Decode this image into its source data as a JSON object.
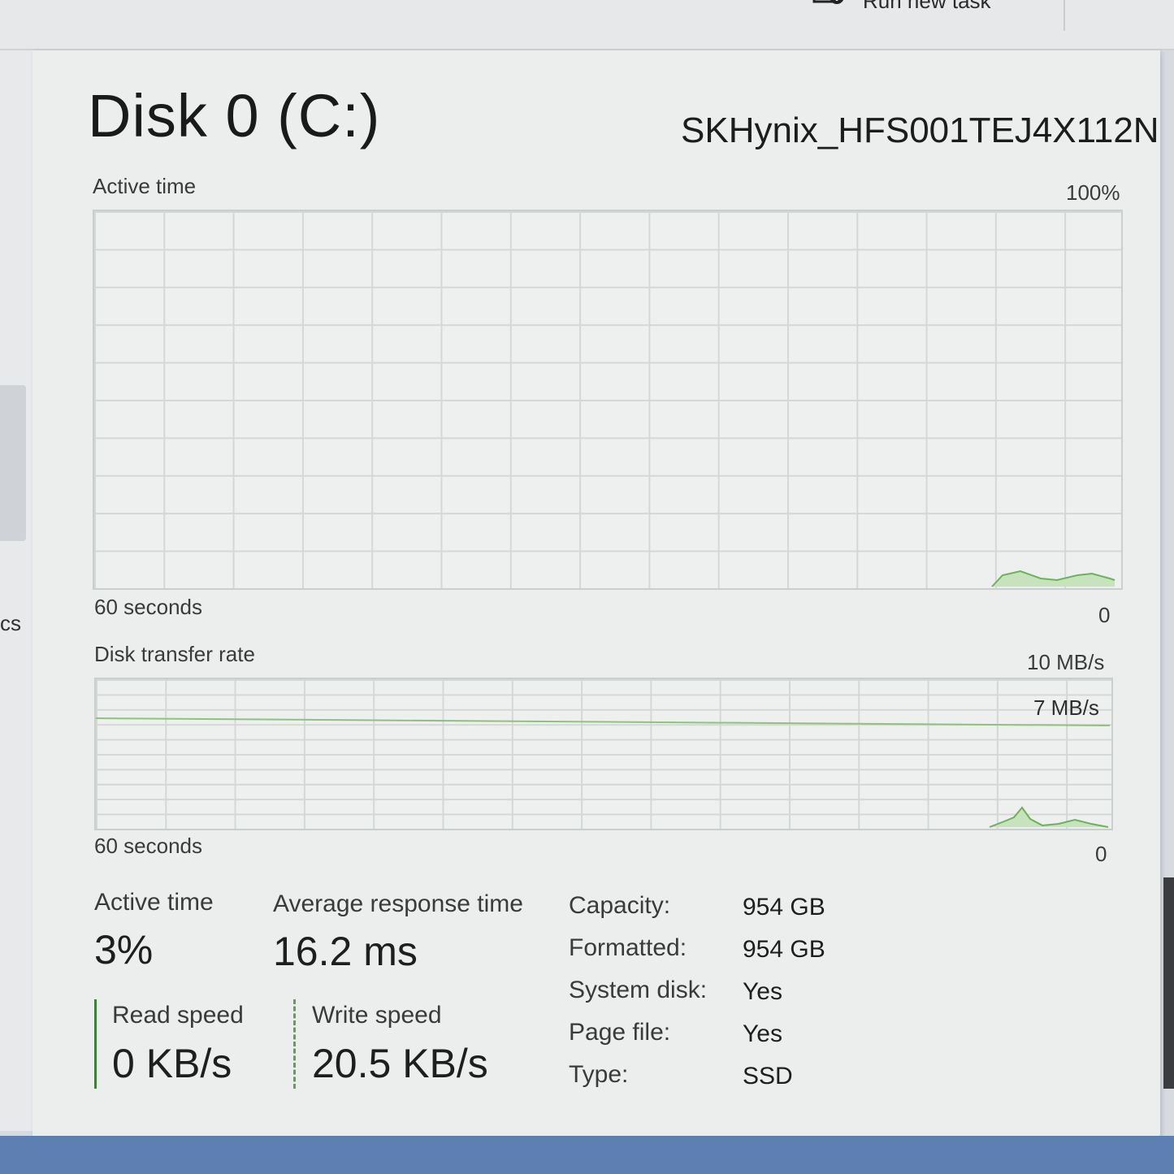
{
  "toolbar": {
    "run_new_task_label": "Run new task"
  },
  "sidebar": {
    "partial_label": "cs"
  },
  "disk": {
    "title": "Disk 0 (C:)",
    "model": "SKHynix_HFS001TEJ4X112N"
  },
  "active_time_graph": {
    "label": "Active time",
    "max_label": "100%",
    "time_label": "60 seconds",
    "min_label": "0"
  },
  "transfer_graph": {
    "label": "Disk transfer rate",
    "max_label": "10 MB/s",
    "marker_label": "7 MB/s",
    "time_label": "60 seconds",
    "min_label": "0"
  },
  "stats": {
    "active_time_label": "Active time",
    "active_time_value": "3%",
    "response_label": "Average response time",
    "response_value": "16.2 ms",
    "read_label": "Read speed",
    "read_value": "0 KB/s",
    "write_label": "Write speed",
    "write_value": "20.5 KB/s"
  },
  "properties": [
    {
      "label": "Capacity:",
      "value": "954 GB"
    },
    {
      "label": "Formatted:",
      "value": "954 GB"
    },
    {
      "label": "System disk:",
      "value": "Yes"
    },
    {
      "label": "Page file:",
      "value": "Yes"
    },
    {
      "label": "Type:",
      "value": "SSD"
    }
  ],
  "colors": {
    "graph_line": "#6fb05a",
    "graph_fill": "#c7e3bd",
    "read_accent": "#3f7f3a"
  }
}
